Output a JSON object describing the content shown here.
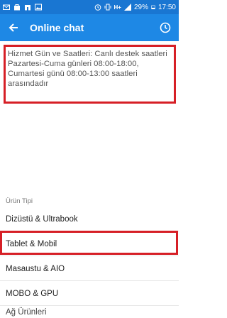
{
  "status_bar": {
    "battery_percent": "29%",
    "time": "17:50",
    "signal_label": "H+"
  },
  "app_bar": {
    "title": "Online chat"
  },
  "service_hours": {
    "text": "Hizmet Gün ve Saatleri: Canlı destek saatleri Pazartesi-Cuma günleri 08:00-18:00, Cumartesi günü 08:00-13:00 saatleri arasındadır"
  },
  "product_type": {
    "label": "Ürün Tipi",
    "items": [
      {
        "label": "Dizüstü & Ultrabook"
      },
      {
        "label": "Tablet & Mobil"
      },
      {
        "label": "Masaustu & AIO"
      },
      {
        "label": "MOBO & GPU"
      },
      {
        "label": "Ağ Ürünleri"
      }
    ],
    "highlighted_index": 1
  },
  "colors": {
    "app_bar": "#1e88e5",
    "status_bar": "#1976d2",
    "highlight_border": "#d61f26"
  }
}
